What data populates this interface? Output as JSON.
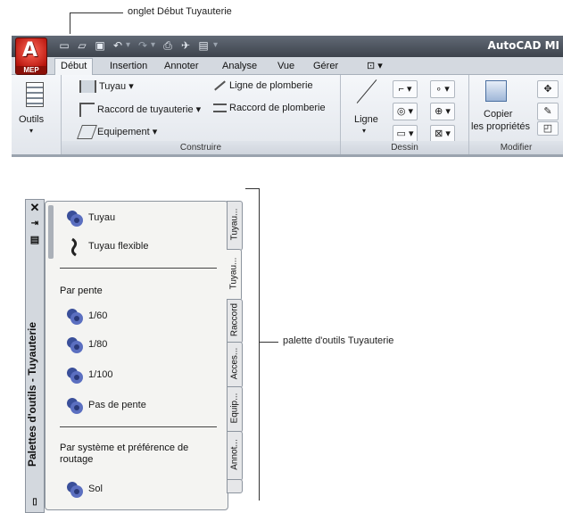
{
  "callouts": {
    "tab": "onglet Début Tuyauterie",
    "palette": "palette d'outils Tuyauterie"
  },
  "app": {
    "title": "AutoCAD MI",
    "badge": "MEP"
  },
  "tabs": [
    "Début",
    "Insertion",
    "Annoter",
    "Analyse",
    "Vue",
    "Gérer"
  ],
  "panels": {
    "outils": "Outils",
    "construire": {
      "title": "Construire",
      "tuyau": "Tuyau",
      "raccord": "Raccord de tuyauterie",
      "equipement": "Equipement",
      "ligne_plomberie": "Ligne de plomberie",
      "raccord_plomberie": "Raccord de plomberie"
    },
    "dessin": {
      "title": "Dessin",
      "ligne": "Ligne"
    },
    "modifier": {
      "title": "Modifier",
      "copier": "Copier",
      "proprietes": "les propriétés"
    }
  },
  "palette": {
    "title": "Palettes d'outils - Tuyauterie",
    "items_top": [
      "Tuyau",
      "Tuyau flexible"
    ],
    "heading_pente": "Par pente",
    "items_pente": [
      "1/60",
      "1/80",
      "1/100",
      "Pas de pente"
    ],
    "heading_systeme": "Par système et préférence de routage",
    "items_systeme": [
      "Sol"
    ],
    "tabs": [
      "Tuyau...",
      "Tuyau...",
      "Raccord",
      "Acces...",
      "Equip...",
      "Annot..."
    ]
  }
}
